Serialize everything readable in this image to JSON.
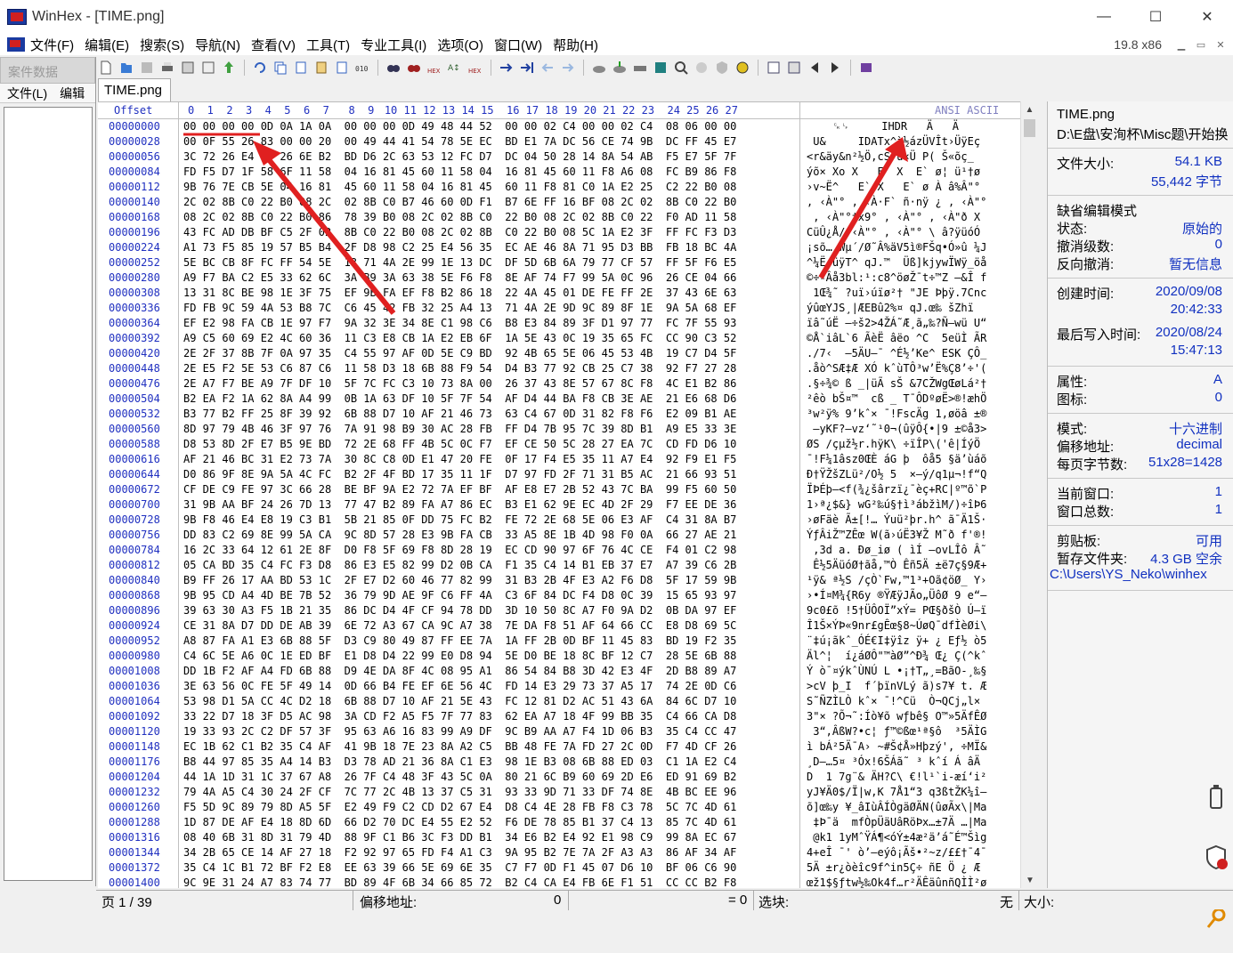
{
  "window": {
    "title": "WinHex - [TIME.png]",
    "min": "—",
    "max": "☐",
    "close": "✕"
  },
  "menu": {
    "items": [
      "文件(F)",
      "编辑(E)",
      "搜索(S)",
      "导航(N)",
      "查看(V)",
      "工具(T)",
      "专业工具(I)",
      "选项(O)",
      "窗口(W)",
      "帮助(H)"
    ],
    "zoom": "19.8 x86"
  },
  "case": {
    "title": "案件数据",
    "file_menu": "文件(L)",
    "edit_menu": "编辑"
  },
  "tab": {
    "label": "TIME.png"
  },
  "hex": {
    "offset_header": "Offset",
    "ansi_header": "ANSI ASCII",
    "columns": [
      "0",
      "1",
      "2",
      "3",
      "4",
      "5",
      "6",
      "7",
      "8",
      "9",
      "10",
      "11",
      "12",
      "13",
      "14",
      "15",
      "16",
      "17",
      "18",
      "19",
      "20",
      "21",
      "22",
      "23",
      "24",
      "25",
      "26",
      "27"
    ],
    "rows": [
      {
        "off": "00000000",
        "hex": "00 00 00 00 0D 0A 1A 0A  00 00 00 0D 49 48 44 52  00 00 02 C4 00 00 02 C4  08 06 00 00",
        "ascii": "    ␍␊     IHDR   Ä   Ä"
      },
      {
        "off": "00000028",
        "hex": "00 0F 55 26 83 00 00 20  00 49 44 41 54 78 5E EC  BD E1 7A DC 56 CE 74 9B  DC FF 45 E7",
        "ascii": " U&     IDATx^ì½ázÜVÎt›ÜÿEç"
      },
      {
        "off": "00000056",
        "hex": "3C 72 26 E4 79 26 6E B2  BD D6 2C 63 53 12 FC D7  DC 04 50 28 14 8A 54 AB  F5 E7 5F 7F",
        "ascii": "<r&äy&n²½Ö,cS ü×Ü P( Š«õç_"
      },
      {
        "off": "00000084",
        "hex": "FD F5 D7 1F 58 6F 11 58  04 16 81 45 60 11 58 04  16 81 45 60 11 F8 A6 08  FC B9 86 F8",
        "ascii": "ýõ× Xo X   E` X  E` ø¦ ü¹†ø"
      },
      {
        "off": "00000112",
        "hex": "9B 76 7E CB 5E 04 16 81  45 60 11 58 04 16 81 45  60 11 F8 81 C0 1A E2 25  C2 22 B0 08",
        "ascii": "›v~Ë^   E` X   E` ø À â%Â\"° "
      },
      {
        "off": "00000140",
        "hex": "2C 02 8B C0 22 B0 08 2C  02 8B C0 B7 46 60 0D F1  B7 6E FF 16 BF 08 2C 02  8B C0 22 B0",
        "ascii": ", ‹À\"° , ‹À·F` ñ·nÿ ¿ , ‹À\"°"
      },
      {
        "off": "00000168",
        "hex": "08 2C 02 8B C0 22 B0 86  78 39 B0 08 2C 02 8B C0  22 B0 08 2C 02 8B C0 22  F0 AD 11 58",
        "ascii": " , ‹À\"°†x9° , ‹À\"° , ‹À\"ð­ X"
      },
      {
        "off": "00000196",
        "hex": "43 FC AD DB BF C5 2F 02  8B C0 22 B0 08 2C 02 8B  C0 22 B0 08 5C 1A E2 3F  FF FC F3 D3",
        "ascii": "Cü­Û¿Å/ ‹À\"° , ‹À\"° \\ â?ÿüóÓ"
      },
      {
        "off": "00000224",
        "hex": "A1 73 F5 85 19 57 B5 B4  2F D8 98 C2 25 E4 56 35  EC AE 46 8A 71 95 D3 BB  FB 18 BC 4A",
        "ascii": "¡sõ… Wµ´/Ø˜Â%äV5ì®FŠq•Ó»û ¼J"
      },
      {
        "off": "00000252",
        "hex": "5E BC CB 8F FC FF 54 5E  13 71 4A 2E 99 1E 13 DC  DF 5D 6B 6A 79 77 CF 57  FF 5F F6 E5",
        "ascii": "^¼Ë üÿT^ qJ.™  Üß]kjywÏWÿ_öå"
      },
      {
        "off": "00000280",
        "hex": "A9 F7 BA C2 E5 33 62 6C  3A B9 3A 63 38 5E F6 F8  8E AF 74 F7 99 5A 0C 96  26 CE 04 66",
        "ascii": "©÷ºÂå3bl:¹:c8^öøŽ¯t÷™Z –&Î f"
      },
      {
        "off": "00000308",
        "hex": "13 31 8C BE 98 1E 3F 75  EF 9B FA EF F8 B2 86 18  22 4A 45 01 DE FE FF 2E  37 43 6E 63",
        "ascii": " 1Œ¾˜ ?uï›úïø²† \"JE Þþÿ.7Cnc"
      },
      {
        "off": "00000336",
        "hex": "FD FB 9C 59 4A 53 B8 7C  C6 45 42 FB 32 25 A4 13  71 4A 2E 9D 9C 89 8F 1E  9A 5A 68 EF",
        "ascii": "ýûœYJS¸|ÆEBû2%¤ qJ.œ‰ šZhï"
      },
      {
        "off": "00000364",
        "hex": "EF E2 98 FA CB 1E 97 F7  9A 32 3E 34 8E C1 98 C6  B8 E3 84 89 3F D1 97 77  FC 7F 55 93",
        "ascii": "ïâ˜úË —÷š2>4ŽÁ˜Æ¸ã„‰?Ñ—wü U“"
      },
      {
        "off": "00000392",
        "hex": "A9 C5 60 69 E2 4C 60 36  11 C3 E8 CB 1A E2 EB 6F  1A 5E 43 0C 19 35 65 FC  CC 90 C3 52",
        "ascii": "©Å`iâL`6 ÃèË âëo ^C  5eüÌ ÃR"
      },
      {
        "off": "00000420",
        "hex": "2E 2F 37 8B 7F 0A 97 35  C4 55 97 AF 0D 5E C9 BD  92 4B 65 5E 06 45 53 4B  19 C7 D4 5F",
        "ascii": "./7‹  —5ÄU—¯ ^É½’Ke^ ESK ÇÔ_"
      },
      {
        "off": "00000448",
        "hex": "2E E5 F2 5E 53 C6 87 C6  11 58 D3 18 6B 88 F9 54  D4 B3 77 92 CB 25 C7 38  92 F7 27 28",
        "ascii": ".åò^SÆ‡Æ XÓ kˆùTÔ³w’Ë%Ç8’÷'("
      },
      {
        "off": "00000476",
        "hex": "2E A7 F7 BE A9 7F DF 10  5F 7C FC C3 10 73 8A 00  26 37 43 8E 57 67 8C F8  4C E1 B2 86",
        "ascii": ".§÷¾© ß _|üÃ sŠ &7CŽWgŒøLá²†"
      },
      {
        "off": "00000504",
        "hex": "B2 EA F2 1A 62 8A A4 99  0B 1A 63 DF 10 5F 7F 54  AF D4 44 BA F8 CB 3E AE  21 E6 68 D6",
        "ascii": "²êò bŠ¤™  cß _ T¯ÔDºøË>®!æhÖ"
      },
      {
        "off": "00000532",
        "hex": "B3 77 B2 FF 25 8F 39 92  6B 88 D7 10 AF 21 46 73  63 C4 67 0D 31 82 F8 F6  E2 09 B1 AE",
        "ascii": "³w²ÿ% 9’kˆ× ¯!FscÄg 1‚øöâ ±®"
      },
      {
        "off": "00000560",
        "huge": "",
        "hex": "8D 97 79 4B 46 3F 97 76  7A 91 98 B9 30 AC 28 FB  FF D4 7B 95 7C 39 8D B1  A9 E5 33 3E",
        "ascii": " —yKF?—vz‘˜¹0¬(ûÿÔ{•|9 ±©å3>"
      },
      {
        "off": "00000588",
        "hex": "D8 53 8D 2F E7 B5 9E BD  72 2E 68 FF 4B 5C 0C F7  EF CE 50 5C 28 27 EA 7C  CD FD D6 10",
        "ascii": "ØS /çµž½r.hÿK\\ ÷ïÎP\\('ê|ÍýÖ "
      },
      {
        "off": "00000616",
        "hex": "AF 21 46 BC 31 E2 73 7A  30 8C C8 0D E1 47 20 FE  0F 17 F4 E5 35 11 A7 E4  92 F9 E1 F5",
        "ascii": "¯!F¼1âsz0ŒÈ áG þ  ôå5 §ä’ùáõ"
      },
      {
        "off": "00000644",
        "hex": "D0 86 9F 8E 9A 5A 4C FC  B2 2F 4F BD 17 35 11 1F  D7 97 FD 2F 71 31 B5 AC  21 66 93 51",
        "ascii": "Ð†ŸŽšZLü²/O½ 5  ×—ý/q1µ¬!f“Q"
      },
      {
        "off": "00000672",
        "hex": "CF DE C9 FE 97 3C 66 28  BE BF 9A E2 72 7A EF BF  AF E8 E7 2B 52 43 7C BA  99 F5 60 50",
        "ascii": "ÏÞÉþ—<f(¾¿šârzï¿¯èç+RC|º™õ`P"
      },
      {
        "off": "00000700",
        "hex": "31 9B AA BF 24 26 7D 13  77 47 B2 89 FA A7 86 EC  B3 E1 62 9E EC 4D 2F 29  F7 EE DE 36",
        "ascii": "1›ª¿$&} wG²‰ú§†ì³ábžìM/)÷îÞ6"
      },
      {
        "off": "00000728",
        "hex": "9B F8 46 E4 E8 19 C3 B1  5B 21 85 0F DD 75 FC B2  FE 72 2E 68 5E 06 E3 AF  C4 31 8A B7",
        "ascii": "›øFäè Ã±[!… Ýuü²þr.h^ ã¯Ä1Š·"
      },
      {
        "off": "00000756",
        "hex": "DD 83 C2 69 8E 99 5A CA  9C 8D 57 28 E3 9B FA CB  33 A5 8E 1B 4D 98 F0 0A  66 27 AE 21",
        "ascii": "ÝƒÂiŽ™ZÊœ W(ã›úË3¥Ž M˜ð f'®!"
      },
      {
        "off": "00000784",
        "hex": "16 2C 33 64 12 61 2E 8F  D0 F8 5F 69 F8 8D 28 19  EC CD 90 97 6F 76 4C CE  F4 01 C2 98",
        "ascii": " ,3d a. Ðø_iø ( ìÍ —ovLÎô Â˜"
      },
      {
        "off": "00000812",
        "hex": "05 CA BD 35 C4 FC F3 D8  86 E3 E5 82 99 D2 0B CA  F1 35 C4 14 B1 EB 37 E7  A7 39 C6 2B",
        "ascii": " Ê½5ÄüóØ†ãå‚™Ò Êñ5Ä ±ë7ç§9Æ+"
      },
      {
        "off": "00000840",
        "hex": "B9 FF 26 17 AA BD 53 1C  2F E7 D2 60 46 77 82 99  31 B3 2B 4F E3 A2 F6 D8  5F 17 59 9B",
        "ascii": "¹ÿ& ª½S /çÒ`Fw‚™1³+Oã¢öØ_ Y›"
      },
      {
        "off": "00000868",
        "hex": "9B 95 CD A4 4D BE 7B 52  36 79 9D AE 9F C6 FF 4A  C3 6F 84 DC F4 D8 0C 39  15 65 93 97",
        "ascii": "›•Í¤M¾{R6y ®ŸÆÿJÃo„ÜôØ 9 e“—"
      },
      {
        "off": "00000896",
        "hex": "39 63 30 A3 F5 1B 21 35  86 DC D4 4F CF 94 78 DD  3D 10 50 8C A7 F0 9A D2  0B DA 97 EF",
        "ascii": "9c0£õ !5†ÜÔOÏ”xÝ= PŒ§ðšÒ Ú—ï"
      },
      {
        "off": "00000924",
        "hex": "CE 31 8A D7 DD DE AB 39  6E 72 A3 67 CA 9C A7 38  7E DA F8 51 AF 64 66 CC  E8 D8 69 5C",
        "ascii": "Î1Š×ÝÞ«9nr£gÊœ§8~ÚøQ¯dfÌèØi\\"
      },
      {
        "off": "00000952",
        "hex": "A8 87 FA A1 E3 6B 88 5F  D3 C9 80 49 87 FF EE 7A  1A FF 2B 0D BF 11 45 83  BD 19 F2 35",
        "ascii": "¨‡ú¡ãkˆ_ÓÉ€I‡ÿîz ÿ+ ¿ Eƒ½ ò5"
      },
      {
        "off": "00000980",
        "hex": "C4 6C 5E A6 0C 1E ED BF  E1 D8 D4 22 99 E0 D8 94  5E D0 BE 18 8C BF 12 C7  28 5E 6B 88",
        "ascii": "Äl^¦  í¿áØÔ\"™àØ”^Ð¾ Œ¿ Ç(^kˆ"
      },
      {
        "off": "00001008",
        "hex": "DD 1B F2 AF A4 FD 6B 88  D9 4E DA 8F 4C 08 95 A1  86 54 84 B8 3D 42 E3 4F  2D B8 89 A7",
        "ascii": "Ý ò¯¤ýkˆÙNÚ L •¡†T„¸=BãO-¸‰§"
      },
      {
        "off": "00001036",
        "hex": "3E 63 56 0C FE 5F 49 14  0D 66 B4 FE EF 6E 56 4C  FD 14 E3 29 73 37 A5 17  74 2E 0D C6",
        "ascii": ">cV þ_I  f´þïnVLý ã)s7¥ t. Æ"
      },
      {
        "off": "00001064",
        "hex": "53 98 D1 5A CC 4C D2 18  6B 88 D7 10 AF 21 5E 43  FC 12 81 D2 AC 51 43 6A  84 6C D7 10",
        "ascii": "S˜ÑZÌLÒ kˆ× ¯!^Cü  Ò¬QCj„l× "
      },
      {
        "off": "00001092",
        "hex": "33 22 D7 18 3F D5 AC 98  3A CD F2 A5 F5 7F 77 83  62 EA A7 18 4F 99 BB 35  C4 66 CA D8",
        "ascii": "3\"× ?Õ¬˜:Íò¥õ wƒbê§ O™»5ÄfÊØ"
      },
      {
        "off": "00001120",
        "hex": "19 33 93 2C C2 DF 57 3F  95 63 A6 16 83 99 A9 DF  9C B9 AA A7 F4 1D 06 B3  35 C4 CC 47",
        "ascii": " 3“,ÂßW?•c¦ ƒ™©ßœ¹ª§ô  ³5ÄÌG"
      },
      {
        "off": "00001148",
        "hex": "EC 1B 62 C1 B2 35 C4 AF  41 9B 18 7E 23 8A A2 C5  BB 48 FE 7A FD 27 2C 0D  F7 4D CF 26",
        "ascii": "ì bÁ²5Ä¯A› ~#Š¢Å»Hþzý', ÷MÏ&"
      },
      {
        "off": "00001176",
        "hex": "B8 44 97 85 35 A4 14 B3  D3 78 AD 21 36 8A C1 E3  98 1E B3 08 6B 88 ED 03  C1 1A E2 C4",
        "ascii": "¸D—…5¤ ³Óx­!6ŠÁã˜ ³ kˆí Á âÄ"
      },
      {
        "off": "00001204",
        "hex": "44 1A 1D 31 1C 37 67 A8  26 7F C4 48 3F 43 5C 0A  80 21 6C B9 60 69 2D E6  ED 91 69 B2",
        "ascii": "D  1 7g¨& ÄH?C\\ €!l¹`i-æí‘i²"
      },
      {
        "off": "00001232",
        "hex": "79 4A A5 C4 30 24 2F CF  7C 77 2C 4B 13 37 C5 31  93 33 9D 71 33 DF 74 8E  4B BC EE 96",
        "ascii": "yJ¥Ä0$/Ï|w,K 7Å1“3 q3ßtŽK¼î–"
      },
      {
        "off": "00001260",
        "hex": "F5 5D 9C 89 79 8D A5 5F  E2 49 F9 C2 CD D2 67 E4  D8 C4 4E 28 FB F8 C3 78  5C 7C 4D 61",
        "ascii": "õ]œ‰y ¥_âIùÂÍÒgäØÄN(ûøÃx\\|Ma"
      },
      {
        "off": "00001288",
        "hex": "1D 87 DE AF E4 18 8D 6D  66 D2 70 DC E4 55 E2 52  F6 DE 78 85 B1 37 C4 13  85 7C 4D 61",
        "ascii": " ‡Þ¯ä  mfÒpÜäUâRöÞx…±7Ä …|Ma"
      },
      {
        "off": "00001316",
        "hex": "08 40 6B 31 8D 31 79 4D  88 9F C1 B6 3C F3 DD B1  34 E6 B2 E4 92 E1 98 C9  99 8A EC 67",
        "ascii": " @k1 1yMˆŸÁ¶<óÝ±4æ²ä’á˜É™Šìg"
      },
      {
        "off": "00001344",
        "hex": "34 2B 65 CE 14 AF 27 18  F2 92 97 65 FD F4 A1 C3  9A 95 B2 7E 7A 2F A3 A3  86 AF 34 AF",
        "ascii": "4+eÎ ¯' ò’—eýô¡Ãš•²~z/££†¯4¯"
      },
      {
        "off": "00001372",
        "hex": "35 C4 1C B1 72 BF F2 E8  EE 63 39 66 5E 69 6E 35  C7 F7 0D F1 45 07 D6 10  BF 06 C6 90",
        "ascii": "5Ä ±r¿òèîc9f^in5Ç÷ ñE Ö ¿ Æ"
      },
      {
        "off": "00001400",
        "hex": "9C 9E 31 24 A7 83 74 77  BD 89 4F 6B 34 66 85 72  B2 C4 CA E4 FB 6E F1 51  CC CC B2 F8",
        "ascii": "œž1$§ƒtw½‰Ok4f…r²ÄÊäûnñQÌÌ²ø"
      }
    ]
  },
  "info": {
    "filename": "TIME.png",
    "path": "D:\\E盘\\安洵杯\\Misc题\\开始换",
    "size_label": "文件大小:",
    "size_kb": "54.1 KB",
    "size_bytes": "55,442 字节",
    "default_mode": "缺省编辑模式",
    "state_label": "状态:",
    "state_value": "原始的",
    "undo_label": "撤消级数:",
    "undo_value": "0",
    "redo_label": "反向撤消:",
    "redo_value": "暂无信息",
    "created_label": "创建时间:",
    "created_date": "2020/09/08",
    "created_time": "20:42:33",
    "modified_label": "最后写入时间:",
    "modified_date": "2020/08/24",
    "modified_time": "15:47:13",
    "attr_label": "属性:",
    "attr_value": "A",
    "icon_label": "图标:",
    "icon_value": "0",
    "mode_label": "模式:",
    "mode_value": "十六进制",
    "offset_label": "偏移地址:",
    "offset_value": "decimal",
    "bpp_label": "每页字节数:",
    "bpp_value": "51x28=1428",
    "curwin_label": "当前窗口:",
    "curwin_value": "1",
    "totwin_label": "窗口总数:",
    "totwin_value": "1",
    "clip_label": "剪贴板:",
    "clip_value": "可用",
    "temp_label": "暂存文件夹:",
    "temp_value": "4.3 GB 空余",
    "temp_path": "C:\\Users\\YS_Neko\\winhex"
  },
  "status": {
    "page": "页 1 / 39",
    "offset_label": "偏移地址:",
    "offset_value": "0",
    "eq": "= 0",
    "block_label": "选块:",
    "block_value": "无",
    "size_label": "大小:"
  }
}
